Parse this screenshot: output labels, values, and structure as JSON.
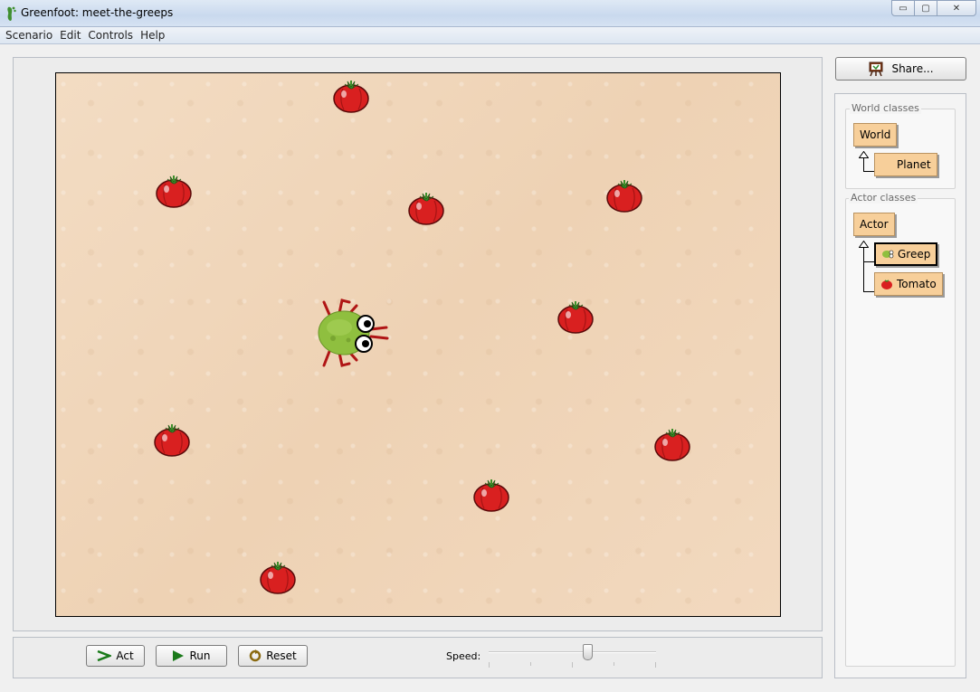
{
  "window": {
    "title": "Greenfoot: meet-the-greeps",
    "min_glyph": "▭",
    "max_glyph": "▢",
    "close_glyph": "✕"
  },
  "menu": [
    "Scenario",
    "Edit",
    "Controls",
    "Help"
  ],
  "world": {
    "background_color": "#f1d8bd",
    "actors": [
      {
        "type": "tomato"
      },
      {
        "type": "tomato"
      },
      {
        "type": "tomato"
      },
      {
        "type": "tomato"
      },
      {
        "type": "tomato"
      },
      {
        "type": "tomato"
      },
      {
        "type": "tomato"
      },
      {
        "type": "tomato"
      },
      {
        "type": "tomato"
      },
      {
        "type": "greep"
      }
    ]
  },
  "controls": {
    "act_label": "Act",
    "run_label": "Run",
    "reset_label": "Reset",
    "speed_label": "Speed:",
    "speed_value": 0.59
  },
  "share": {
    "label": "Share..."
  },
  "classes": {
    "world_title": "World classes",
    "world": "World",
    "planet": "Planet",
    "actor_title": "Actor classes",
    "actor": "Actor",
    "greep": "Greep",
    "tomato": "Tomato",
    "selected": "Greep"
  },
  "colors": {
    "class_fill": "#f7cf9a",
    "tomato": "#d92020",
    "greep": "#8fbf3f"
  }
}
